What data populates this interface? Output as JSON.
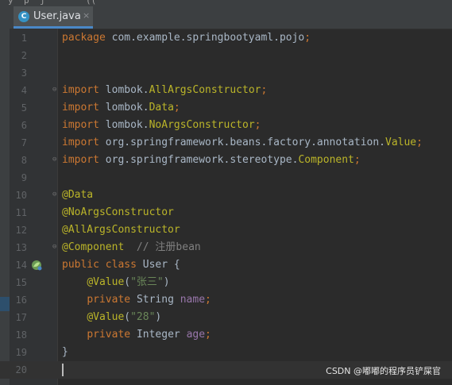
{
  "tab": {
    "label": "User.java",
    "icon": "java-class-icon",
    "close": "×"
  },
  "top_fragments": [
    "y",
    "p",
    "j",
    "(("
  ],
  "lines": [
    {
      "n": "1",
      "parts": [
        {
          "t": "package ",
          "c": "kw"
        },
        {
          "t": "com.example.springbootyaml.pojo",
          "c": ""
        },
        {
          "t": ";",
          "c": "kw"
        }
      ]
    },
    {
      "n": "2",
      "parts": []
    },
    {
      "n": "3",
      "parts": []
    },
    {
      "n": "4",
      "fold": true,
      "parts": [
        {
          "t": "import ",
          "c": "kw"
        },
        {
          "t": "lombok.",
          "c": ""
        },
        {
          "t": "AllArgsConstructor",
          "c": "ann"
        },
        {
          "t": ";",
          "c": "kw"
        }
      ]
    },
    {
      "n": "5",
      "parts": [
        {
          "t": "import ",
          "c": "kw"
        },
        {
          "t": "lombok.",
          "c": ""
        },
        {
          "t": "Data",
          "c": "ann"
        },
        {
          "t": ";",
          "c": "kw"
        }
      ]
    },
    {
      "n": "6",
      "parts": [
        {
          "t": "import ",
          "c": "kw"
        },
        {
          "t": "lombok.",
          "c": ""
        },
        {
          "t": "NoArgsConstructor",
          "c": "ann"
        },
        {
          "t": ";",
          "c": "kw"
        }
      ]
    },
    {
      "n": "7",
      "parts": [
        {
          "t": "import ",
          "c": "kw"
        },
        {
          "t": "org.springframework.beans.factory.annotation.",
          "c": ""
        },
        {
          "t": "Value",
          "c": "ann"
        },
        {
          "t": ";",
          "c": "kw"
        }
      ]
    },
    {
      "n": "8",
      "fold": true,
      "parts": [
        {
          "t": "import ",
          "c": "kw"
        },
        {
          "t": "org.springframework.stereotype.",
          "c": ""
        },
        {
          "t": "Component",
          "c": "ann"
        },
        {
          "t": ";",
          "c": "kw"
        }
      ]
    },
    {
      "n": "9",
      "parts": []
    },
    {
      "n": "10",
      "fold": true,
      "parts": [
        {
          "t": "@Data",
          "c": "ann"
        }
      ]
    },
    {
      "n": "11",
      "parts": [
        {
          "t": "@NoArgsConstructor",
          "c": "ann"
        }
      ]
    },
    {
      "n": "12",
      "parts": [
        {
          "t": "@AllArgsConstructor",
          "c": "ann"
        }
      ]
    },
    {
      "n": "13",
      "fold": true,
      "parts": [
        {
          "t": "@Component",
          "c": "ann"
        },
        {
          "t": "  // 注册bean",
          "c": "cmt"
        }
      ]
    },
    {
      "n": "14",
      "gicon": true,
      "parts": [
        {
          "t": "public class ",
          "c": "kw"
        },
        {
          "t": "User {",
          "c": ""
        }
      ]
    },
    {
      "n": "15",
      "parts": [
        {
          "t": "    ",
          "c": ""
        },
        {
          "t": "@Value",
          "c": "ann"
        },
        {
          "t": "(",
          "c": ""
        },
        {
          "t": "\"张三\"",
          "c": "str"
        },
        {
          "t": ")",
          "c": ""
        }
      ]
    },
    {
      "n": "16",
      "parts": [
        {
          "t": "    ",
          "c": ""
        },
        {
          "t": "private ",
          "c": "kw"
        },
        {
          "t": "String ",
          "c": ""
        },
        {
          "t": "name",
          "c": "fld"
        },
        {
          "t": ";",
          "c": "kw"
        }
      ]
    },
    {
      "n": "17",
      "parts": [
        {
          "t": "    ",
          "c": ""
        },
        {
          "t": "@Value",
          "c": "ann"
        },
        {
          "t": "(",
          "c": ""
        },
        {
          "t": "\"28\"",
          "c": "str"
        },
        {
          "t": ")",
          "c": ""
        }
      ]
    },
    {
      "n": "18",
      "parts": [
        {
          "t": "    ",
          "c": ""
        },
        {
          "t": "private ",
          "c": "kw"
        },
        {
          "t": "Integer ",
          "c": ""
        },
        {
          "t": "age",
          "c": "fld"
        },
        {
          "t": ";",
          "c": "kw"
        }
      ]
    },
    {
      "n": "19",
      "parts": [
        {
          "t": "}",
          "c": ""
        }
      ]
    },
    {
      "n": "20",
      "current": true,
      "parts": []
    }
  ],
  "watermark": "CSDN @嘟嘟的程序员铲屎官",
  "colors": {
    "keyword": "#cc7832",
    "annotation": "#bbb529",
    "string": "#6a8759",
    "field": "#9876aa",
    "comment": "#808080",
    "text": "#a9b7c6"
  }
}
